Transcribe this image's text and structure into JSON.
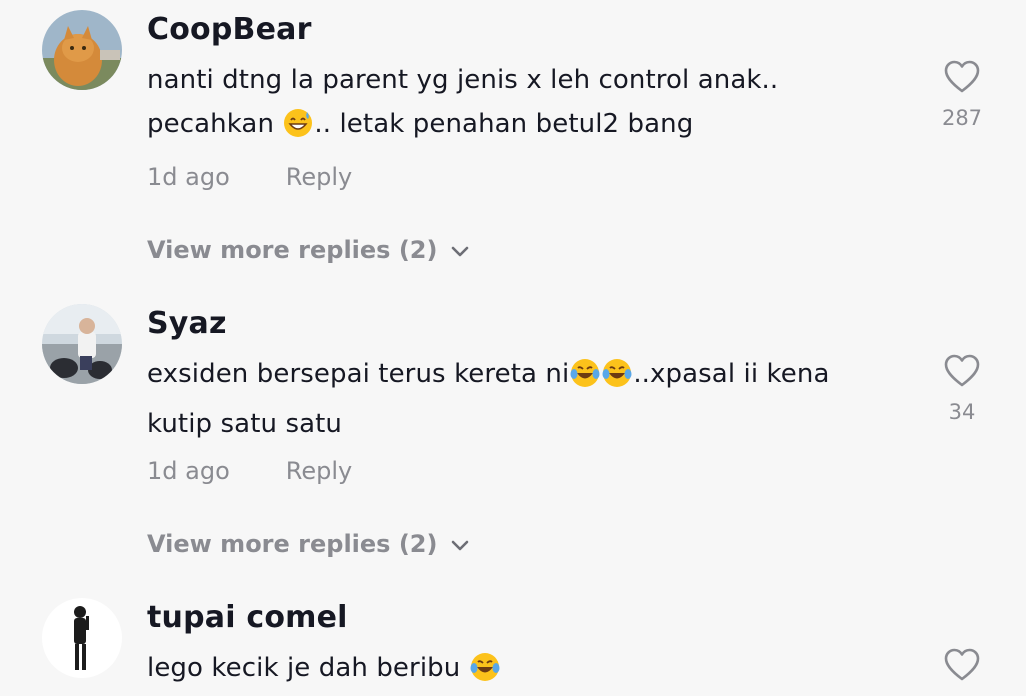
{
  "comments": [
    {
      "username": "CoopBear",
      "text_line1": "nanti dtng la parent yg jenis x leh control anak..",
      "text_line2a": "pecahkan ",
      "text_line2b": ".. letak penahan betul2 bang",
      "emoji_icons": [
        "grinning-sweat-emoji-icon"
      ],
      "time": "1d ago",
      "reply_label": "Reply",
      "view_more": "View more replies (2)",
      "likes": "287"
    },
    {
      "username": "Syaz",
      "text_line1a": "exsiden bersepai terus kereta ni",
      "text_line1b": "..xpasal ii kena",
      "text_line2": "kutip satu satu",
      "emoji_icons": [
        "tears-of-joy-emoji-icon",
        "tears-of-joy-emoji-icon"
      ],
      "time": "1d ago",
      "reply_label": "Reply",
      "view_more": "View more replies (2)",
      "likes": "34"
    },
    {
      "username": "tupai comel",
      "text_line1": "lego kecik je dah beribu ",
      "emoji_icons": [
        "tears-of-joy-emoji-icon"
      ]
    }
  ],
  "colors": {
    "background": "#f7f7f7",
    "primary_text": "#161823",
    "secondary_text": "#8a8b91"
  }
}
